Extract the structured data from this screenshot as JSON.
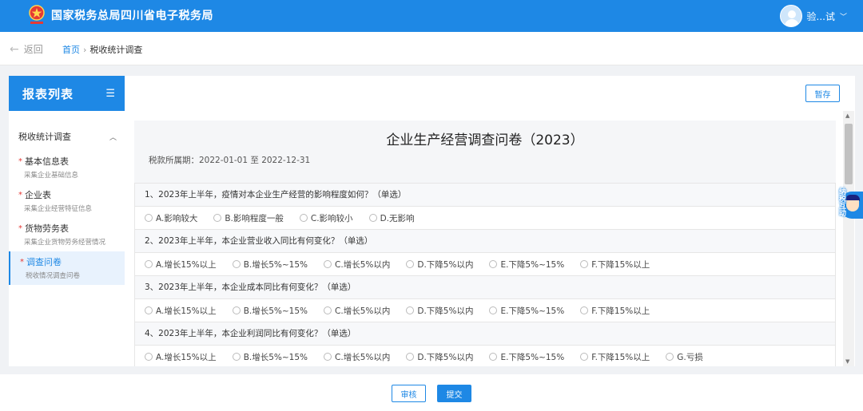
{
  "header": {
    "brand": "国家税务总局四川省电子税务局",
    "username": "验...试",
    "colors": {
      "primary": "#1e88e5"
    }
  },
  "nav": {
    "back_label": "返回",
    "breadcrumb": {
      "home": "首页",
      "separator": "›",
      "current": "税收统计调查"
    }
  },
  "sidebar": {
    "title": "报表列表",
    "group": "税收统计调查",
    "items": [
      {
        "label": "基本信息表",
        "sub": "采集企业基础信息",
        "required": "*"
      },
      {
        "label": "企业表",
        "sub": "采集企业经营特征信息",
        "required": "*"
      },
      {
        "label": "货物劳务表",
        "sub": "采集企业货物劳务经营情况",
        "required": "*"
      },
      {
        "label": "调查问卷",
        "sub": "税收情况调查问卷",
        "required": "*"
      }
    ]
  },
  "main": {
    "save_label": "暂存",
    "title": "企业生产经营调查问卷（2023）",
    "period": "税款所属期：2022-01-01 至 2022-12-31",
    "questions": [
      {
        "title": "1、2023年上半年，疫情对本企业生产经营的影响程度如何？（单选）",
        "options": [
          "A.影响较大",
          "B.影响程度一般",
          "C.影响较小",
          "D.无影响"
        ]
      },
      {
        "title": "2、2023年上半年，本企业营业收入同比有何变化？（单选）",
        "options": [
          "A.增长15%以上",
          "B.增长5%~15%",
          "C.增长5%以内",
          "D.下降5%以内",
          "E.下降5%~15%",
          "F.下降15%以上"
        ]
      },
      {
        "title": "3、2023年上半年，本企业成本同比有何变化？（单选）",
        "options": [
          "A.增长15%以上",
          "B.增长5%~15%",
          "C.增长5%以内",
          "D.下降5%以内",
          "E.下降5%~15%",
          "F.下降15%以上"
        ]
      },
      {
        "title": "4、2023年上半年，本企业利润同比有何变化？（单选）",
        "options": [
          "A.增长15%以上",
          "B.增长5%~15%",
          "C.增长5%以内",
          "D.下降5%以内",
          "E.下降5%~15%",
          "F.下降15%以上",
          "G.亏损"
        ]
      }
    ]
  },
  "helper": {
    "label": "纳税互动"
  },
  "footer": {
    "review_label": "审核",
    "submit_label": "提交"
  }
}
